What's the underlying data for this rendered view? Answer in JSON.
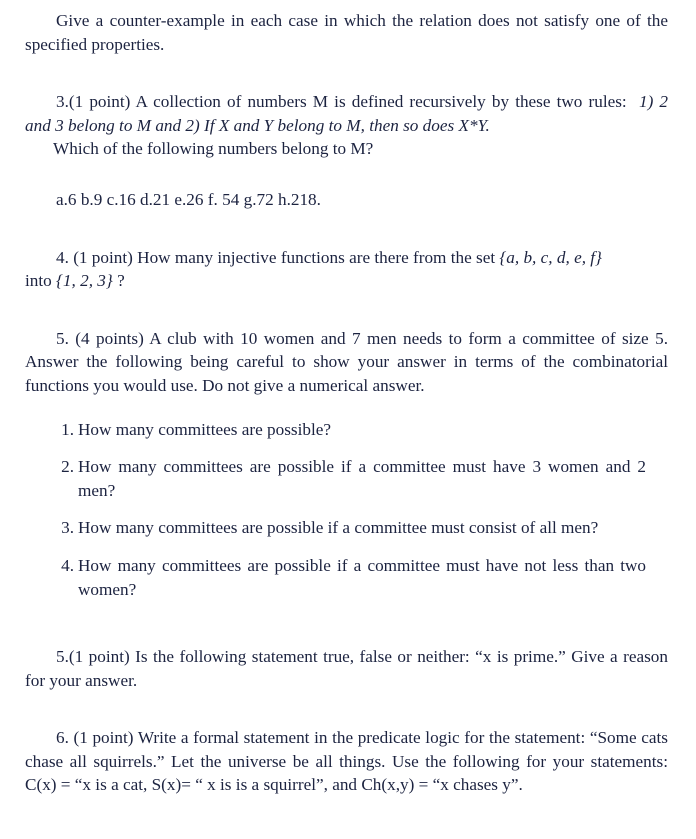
{
  "document": {
    "type": "math-exam-worksheet",
    "ink_color": "#1c2340",
    "page_color": "#ffffff"
  },
  "intro_paragraph": {
    "text": "Give a counter-example in each case in which the relation does not satisfy one of the specified properties."
  },
  "question3": {
    "lead": "3.(1 point) A collection of numbers M is defined recursively by these two rules:",
    "rules_italic": "1) 2 and 3 belong to M and 2) If X and Y belong to M, then so does X*Y.",
    "prompt": "Which of the following numbers belong to M?",
    "choices_line": "a.6 b.9 c.16 d.21 e.26 f. 54 g.72 h.218.",
    "choices": [
      {
        "letter": "a.",
        "value": "6"
      },
      {
        "letter": "b.",
        "value": "9"
      },
      {
        "letter": "c.",
        "value": "16"
      },
      {
        "letter": "d.",
        "value": "21"
      },
      {
        "letter": "e.",
        "value": "26"
      },
      {
        "letter": "f.",
        "value": "54"
      },
      {
        "letter": "g.",
        "value": "72"
      },
      {
        "letter": "h.",
        "value": "218."
      }
    ]
  },
  "question4": {
    "part1": "4. (1 point) How many injective functions are there from the set ",
    "domain_set": "{a, b, c, d, e, f}",
    "part2": "into ",
    "codomain_set": "{1, 2, 3}",
    "part3": " ?"
  },
  "question5": {
    "lead": "5. (4 points) A club with 10 women and 7 men needs to form a committee of size 5. Answer the following being careful to show your answer in terms of the combinatorial functions you would use. Do not give a numerical answer.",
    "items": [
      {
        "num": "1.",
        "text": "How many committees are possible?"
      },
      {
        "num": "2.",
        "text": "How many committees are possible if a committee must have 3 women and 2 men?"
      },
      {
        "num": "3.",
        "text": "How many committees are possible if a committee must consist of all men?"
      },
      {
        "num": "4.",
        "text": "How many committees are possible if a committee must have not less than two women?"
      }
    ]
  },
  "question5b": {
    "text": "5.(1 point) Is the following statement true, false or neither: “x is prime.” Give a reason for your answer."
  },
  "question6": {
    "text": "6. (1 point) Write a formal statement in the predicate logic for the statement: “Some cats chase all squirrels.” Let the universe be all things. Use the following for your statements: C(x) = “x is a cat, S(x)= “ x is is a squirrel”, and Ch(x,y) = “x chases y”."
  }
}
